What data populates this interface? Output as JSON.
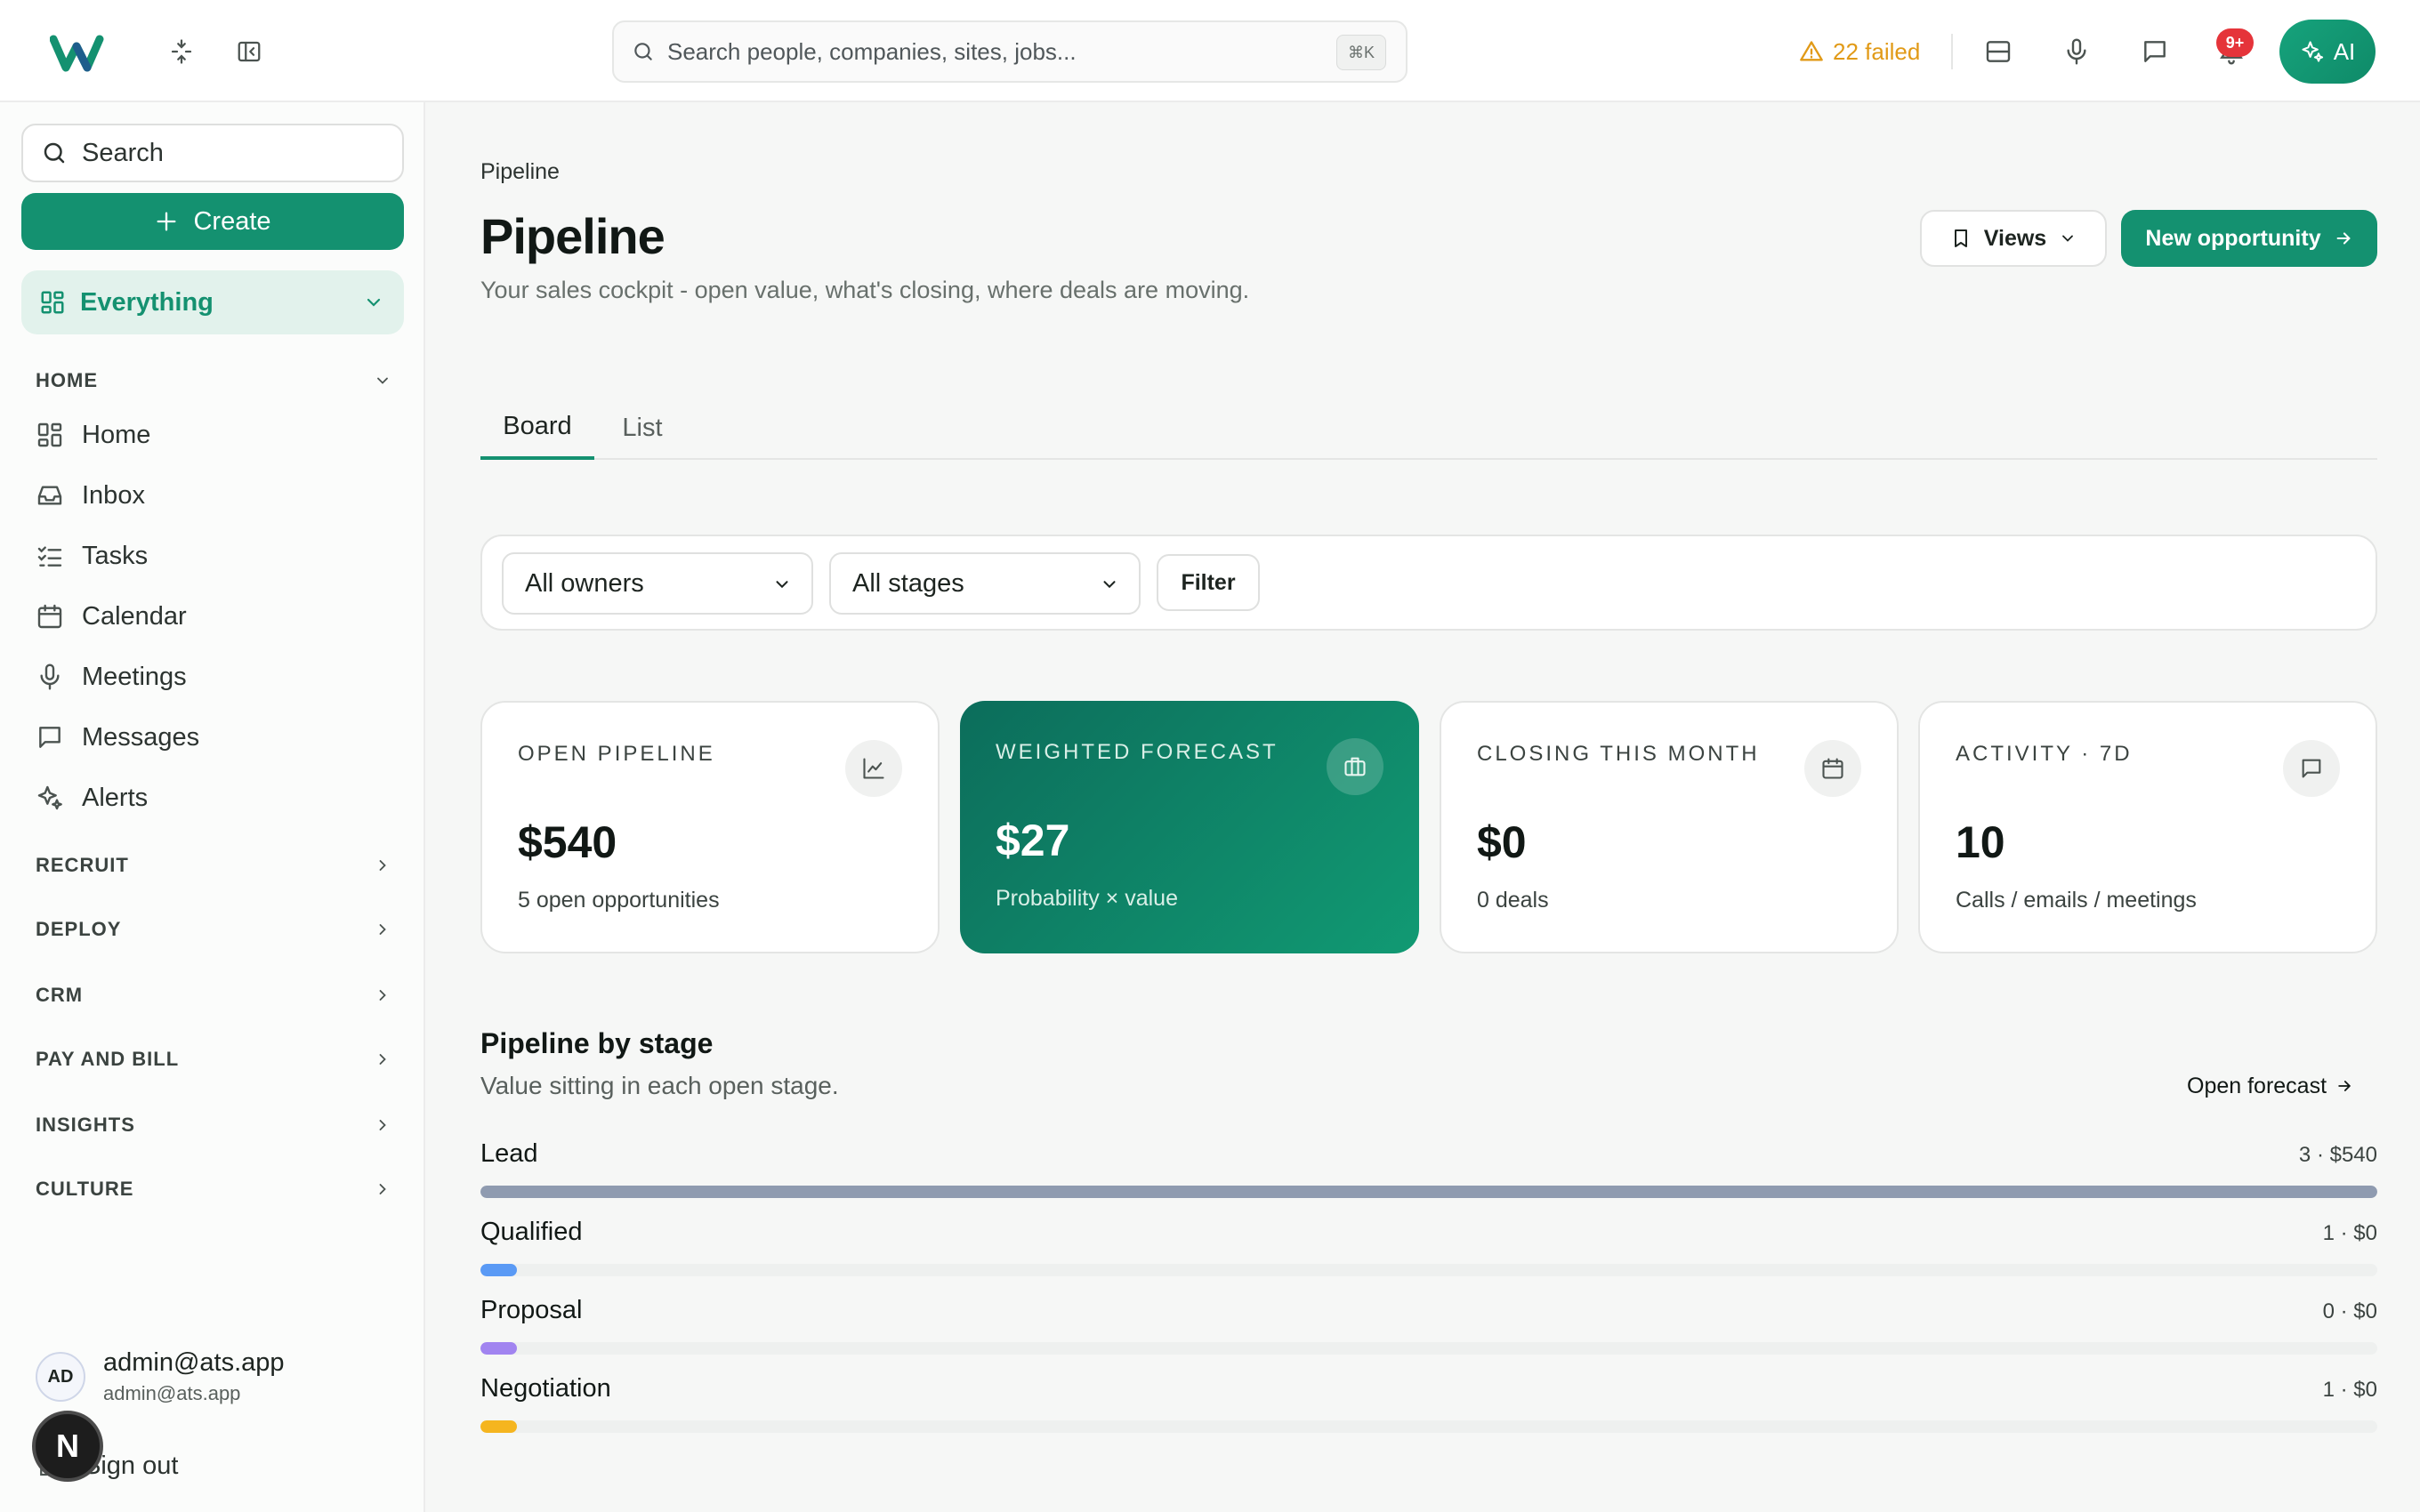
{
  "topbar": {
    "search_placeholder": "Search people, companies, sites, jobs...",
    "search_shortcut": "⌘K",
    "failed_label": "22 failed",
    "notification_count": "9+",
    "ai_label": "AI",
    "brand_color": "#149170",
    "warning_color": "#e19a17",
    "badge_color": "#e5343a"
  },
  "sidebar": {
    "search_label": "Search",
    "create_label": "Create",
    "workspace_label": "Everything",
    "home_section": "HOME",
    "nav_items": [
      {
        "label": "Home",
        "icon": "grid-icon"
      },
      {
        "label": "Inbox",
        "icon": "inbox-icon"
      },
      {
        "label": "Tasks",
        "icon": "checklist-icon"
      },
      {
        "label": "Calendar",
        "icon": "calendar-icon"
      },
      {
        "label": "Meetings",
        "icon": "microphone-icon"
      },
      {
        "label": "Messages",
        "icon": "chat-icon"
      },
      {
        "label": "Alerts",
        "icon": "sparkle-icon"
      }
    ],
    "sections": [
      "RECRUIT",
      "DEPLOY",
      "CRM",
      "PAY AND BILL",
      "INSIGHTS",
      "CULTURE"
    ],
    "user": {
      "initials": "AD",
      "name": "admin@ats.app",
      "email": "admin@ats.app"
    },
    "signout_label": "Sign out",
    "dev_badge": "N"
  },
  "page": {
    "breadcrumb": "Pipeline",
    "title": "Pipeline",
    "subtitle": "Your sales cockpit - open value, what's closing, where deals are moving.",
    "views_label": "Views",
    "new_opportunity_label": "New opportunity",
    "tabs": [
      {
        "label": "Board",
        "active": true
      },
      {
        "label": "List",
        "active": false
      }
    ],
    "filters": {
      "owner_select": "All owners",
      "stage_select": "All stages",
      "filter_label": "Filter"
    }
  },
  "stats": [
    {
      "label": "OPEN PIPELINE",
      "value": "$540",
      "note": "5 open opportunities",
      "icon": "line-chart-icon",
      "highlight": false
    },
    {
      "label": "WEIGHTED FORECAST",
      "value": "$27",
      "note": "Probability × value",
      "icon": "briefcase-icon",
      "highlight": true
    },
    {
      "label": "CLOSING THIS MONTH",
      "value": "$0",
      "note": "0 deals",
      "icon": "calendar-icon",
      "highlight": false
    },
    {
      "label": "ACTIVITY · 7D",
      "value": "10",
      "note": "Calls / emails / meetings",
      "icon": "chat-icon",
      "highlight": false
    }
  ],
  "pipeline_by_stage": {
    "title": "Pipeline by stage",
    "subtitle": "Value sitting in each open stage.",
    "open_forecast_label": "Open forecast",
    "stages": [
      {
        "name": "Lead",
        "meta": "3 · $540",
        "fill_percent": 100,
        "color": "#8f9bb0"
      },
      {
        "name": "Qualified",
        "meta": "1 · $0",
        "fill_percent": 1.9,
        "color": "#5a9af5"
      },
      {
        "name": "Proposal",
        "meta": "0 · $0",
        "fill_percent": 1.9,
        "color": "#a184f0"
      },
      {
        "name": "Negotiation",
        "meta": "1 · $0",
        "fill_percent": 1.9,
        "color": "#f5b51f"
      }
    ]
  }
}
